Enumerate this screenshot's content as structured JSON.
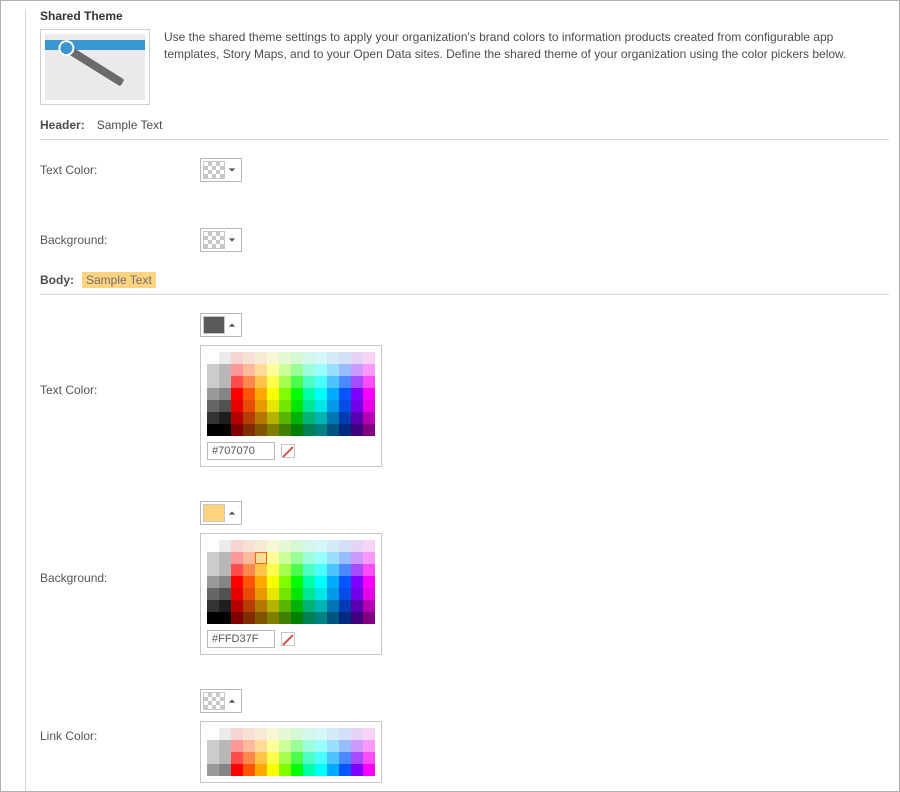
{
  "section": {
    "title": "Shared Theme",
    "intro": "Use the shared theme settings to apply your organization's brand colors to information products created from configurable app templates, Story Maps, and to your Open Data sites. Define the shared theme of your organization using the color pickers below."
  },
  "header": {
    "label": "Header:",
    "sample": "Sample Text",
    "text_color": {
      "label": "Text Color:"
    },
    "background": {
      "label": "Background:"
    }
  },
  "body": {
    "label": "Body:",
    "sample": "Sample Text",
    "text_color": {
      "label": "Text Color:",
      "hex": "#707070",
      "swatch": "#595959"
    },
    "background": {
      "label": "Background:",
      "hex": "#FFD37F",
      "swatch": "#ffd37f"
    },
    "link_color": {
      "label": "Link Color:"
    }
  },
  "icons": {
    "caret_down": "▼",
    "caret_up": "▲"
  }
}
